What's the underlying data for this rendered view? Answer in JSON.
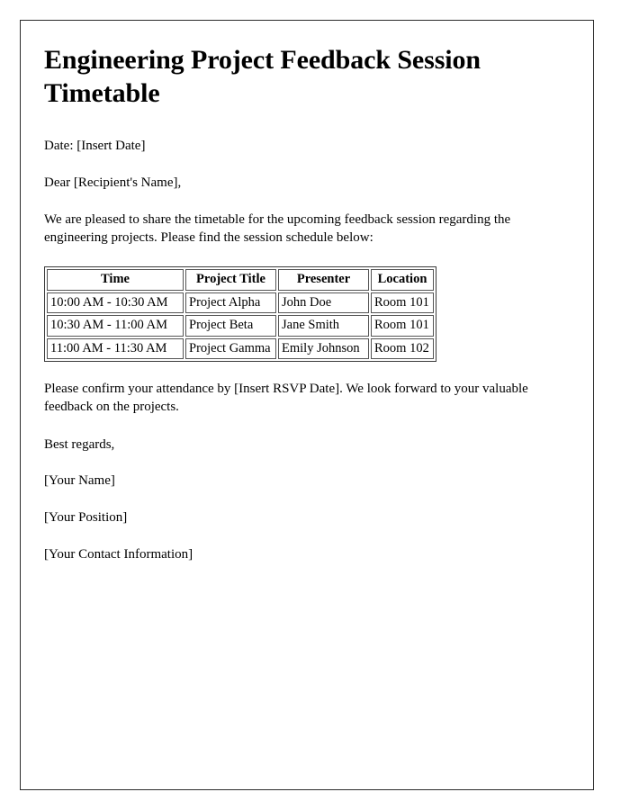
{
  "document": {
    "title": "Engineering Project Feedback Session Timetable",
    "date_line": "Date: [Insert Date]",
    "salutation": "Dear [Recipient's Name],",
    "intro_paragraph": "We are pleased to share the timetable for the upcoming feedback session regarding the engineering projects. Please find the session schedule below:",
    "closing_paragraph": "Please confirm your attendance by [Insert RSVP Date]. We look forward to your valuable feedback on the projects.",
    "signoff": "Best regards,",
    "signature": {
      "name": "[Your Name]",
      "position": "[Your Position]",
      "contact": "[Your Contact Information]"
    }
  },
  "schedule_table": {
    "headers": [
      "Time",
      "Project Title",
      "Presenter",
      "Location"
    ],
    "rows": [
      {
        "time": "10:00 AM - 10:30 AM",
        "project": "Project Alpha",
        "presenter": "John Doe",
        "location": "Room 101"
      },
      {
        "time": "10:30 AM - 11:00 AM",
        "project": "Project Beta",
        "presenter": "Jane Smith",
        "location": "Room 101"
      },
      {
        "time": "11:00 AM - 11:30 AM",
        "project": "Project Gamma",
        "presenter": "Emily Johnson",
        "location": "Room 102"
      }
    ]
  },
  "style": {
    "page_border_color": "#2b2b2b",
    "text_color": "#000000",
    "background_color": "#ffffff"
  }
}
